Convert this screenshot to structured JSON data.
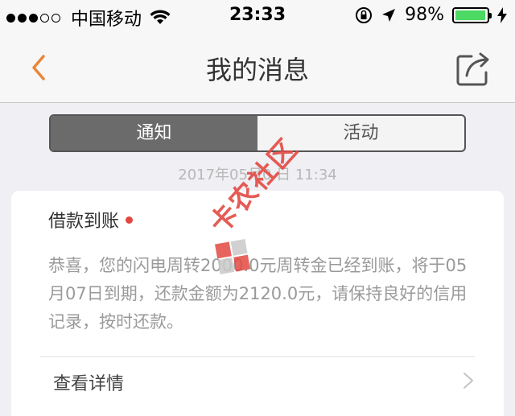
{
  "status_bar": {
    "carrier": "中国移动",
    "time": "23:33",
    "battery_percent": "98%",
    "signal_bars_filled": 3,
    "signal_bars_total": 5
  },
  "nav": {
    "title": "我的消息",
    "back_icon": "chevron-left-icon",
    "share_icon": "share-icon"
  },
  "tabs": [
    {
      "label": "通知",
      "active": true
    },
    {
      "label": "活动",
      "active": false
    }
  ],
  "messages": [
    {
      "timestamp": "2017年05月0 日 11:34",
      "title": "借款到账",
      "unread": true,
      "body": "恭喜，您的闪电周转2000.0元周转金已经到账，将于05月07日到期，还款金额为2120.0元，请保持良好的信用记录，按时还款。",
      "link_label": "查看详情"
    }
  ],
  "watermark": {
    "text": "卡农社区"
  },
  "colors": {
    "accent": "#e8873a",
    "unread_dot": "#e0483e",
    "battery_green": "#4cd964",
    "tab_active_bg": "#6b6b6b"
  }
}
